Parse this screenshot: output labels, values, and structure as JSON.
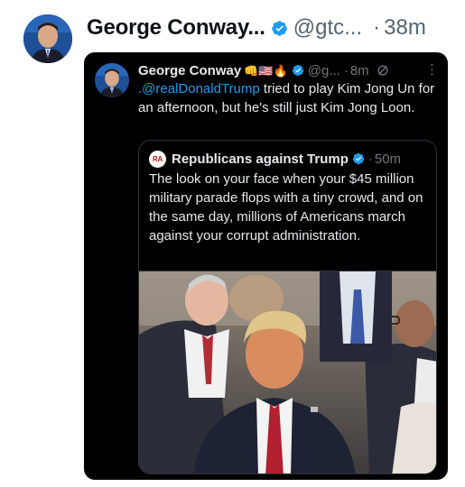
{
  "outer": {
    "name": "George Conway...",
    "handle": "@gtc...",
    "separator": "·",
    "time": "38m"
  },
  "inner": {
    "name": "George Conway",
    "emojis": "👊🇺🇸🔥",
    "handle": "@g...",
    "separator": "·",
    "time": "8m",
    "more": "⋮",
    "mention": ".@realDonaldTrump",
    "text": " tried to play Kim Jong Un for an afternoon, but he's still just Kim Jong Loon."
  },
  "quote": {
    "logo_text": "RA",
    "name": "Republicans against Trump",
    "separator": "·",
    "time": "50m",
    "text": "The look on your face when your $45 million military parade flops with a tiny crowd, and on the same day, millions of Americans march against your corrupt administration."
  },
  "icons": {
    "verified": "verified-badge-icon",
    "grok": "grok-icon",
    "more": "more-icon"
  },
  "colors": {
    "verified_blue": "#1d9bf0",
    "dark_bg": "#000000",
    "mention": "#1d9bf0"
  }
}
